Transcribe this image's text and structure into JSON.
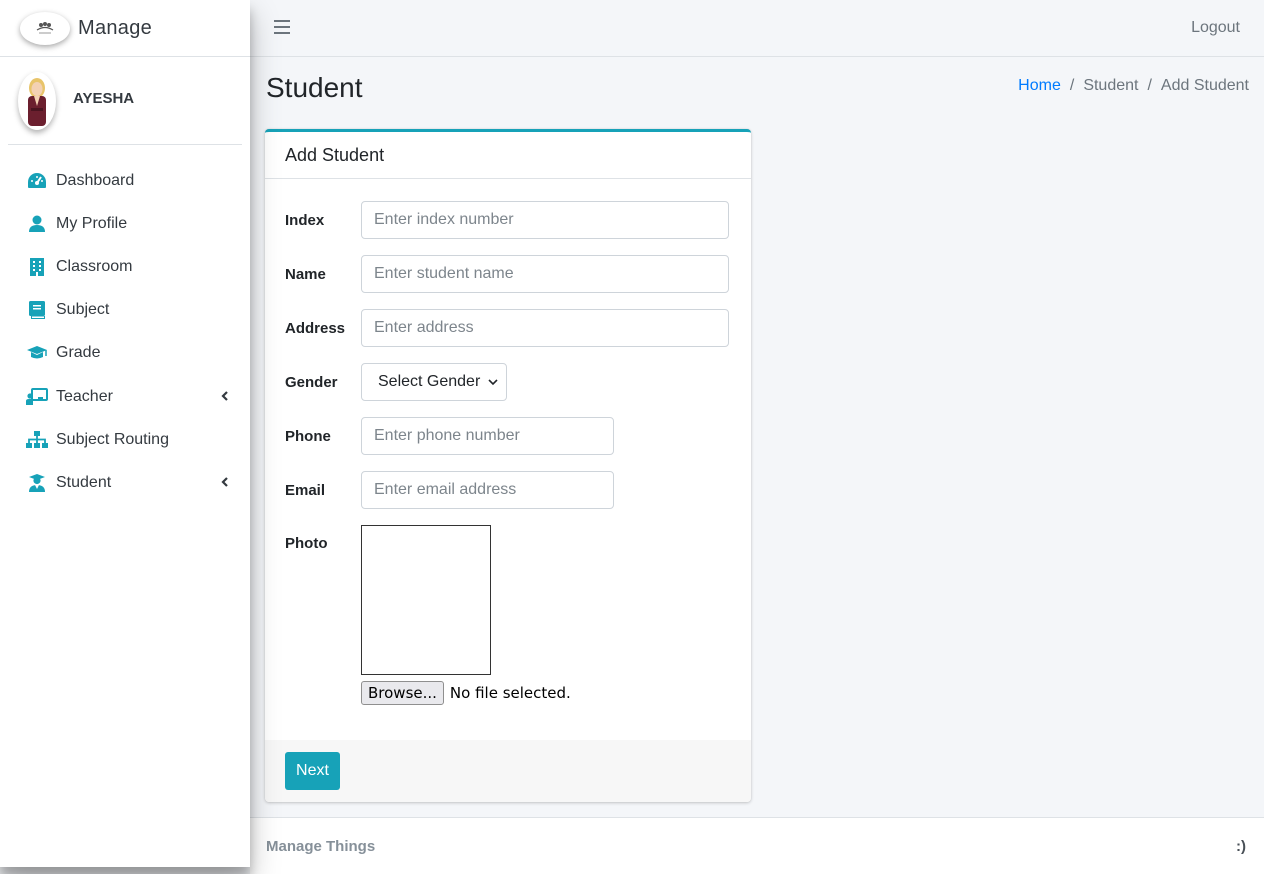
{
  "brand": {
    "name": "Manage"
  },
  "user": {
    "name": "AYESHA"
  },
  "sidebar": {
    "items": [
      {
        "label": "Dashboard",
        "icon": "dashboard-icon"
      },
      {
        "label": "My Profile",
        "icon": "user-icon"
      },
      {
        "label": "Classroom",
        "icon": "building-icon"
      },
      {
        "label": "Subject",
        "icon": "book-icon"
      },
      {
        "label": "Grade",
        "icon": "graduation-cap-icon"
      },
      {
        "label": "Teacher",
        "icon": "chalkboard-teacher-icon",
        "has_children": true
      },
      {
        "label": "Subject Routing",
        "icon": "sitemap-icon"
      },
      {
        "label": "Student",
        "icon": "user-graduate-icon",
        "has_children": true
      }
    ]
  },
  "topbar": {
    "logout_label": "Logout"
  },
  "header": {
    "title": "Student",
    "breadcrumb": [
      "Home",
      "Student",
      "Add Student"
    ]
  },
  "form": {
    "title": "Add Student",
    "fields": {
      "index": {
        "label": "Index",
        "placeholder": "Enter index number"
      },
      "name": {
        "label": "Name",
        "placeholder": "Enter student name"
      },
      "address": {
        "label": "Address",
        "placeholder": "Enter address"
      },
      "gender": {
        "label": "Gender",
        "selected": "Select Gender"
      },
      "phone": {
        "label": "Phone",
        "placeholder": "Enter phone number"
      },
      "email": {
        "label": "Email",
        "placeholder": "Enter email address"
      },
      "photo": {
        "label": "Photo",
        "browse_label": "Browse...",
        "status": "No file selected."
      }
    },
    "submit_label": "Next"
  },
  "footer": {
    "left": "Manage Things",
    "right": ":)"
  },
  "colors": {
    "accent": "#17a2b8",
    "link": "#007bff"
  }
}
